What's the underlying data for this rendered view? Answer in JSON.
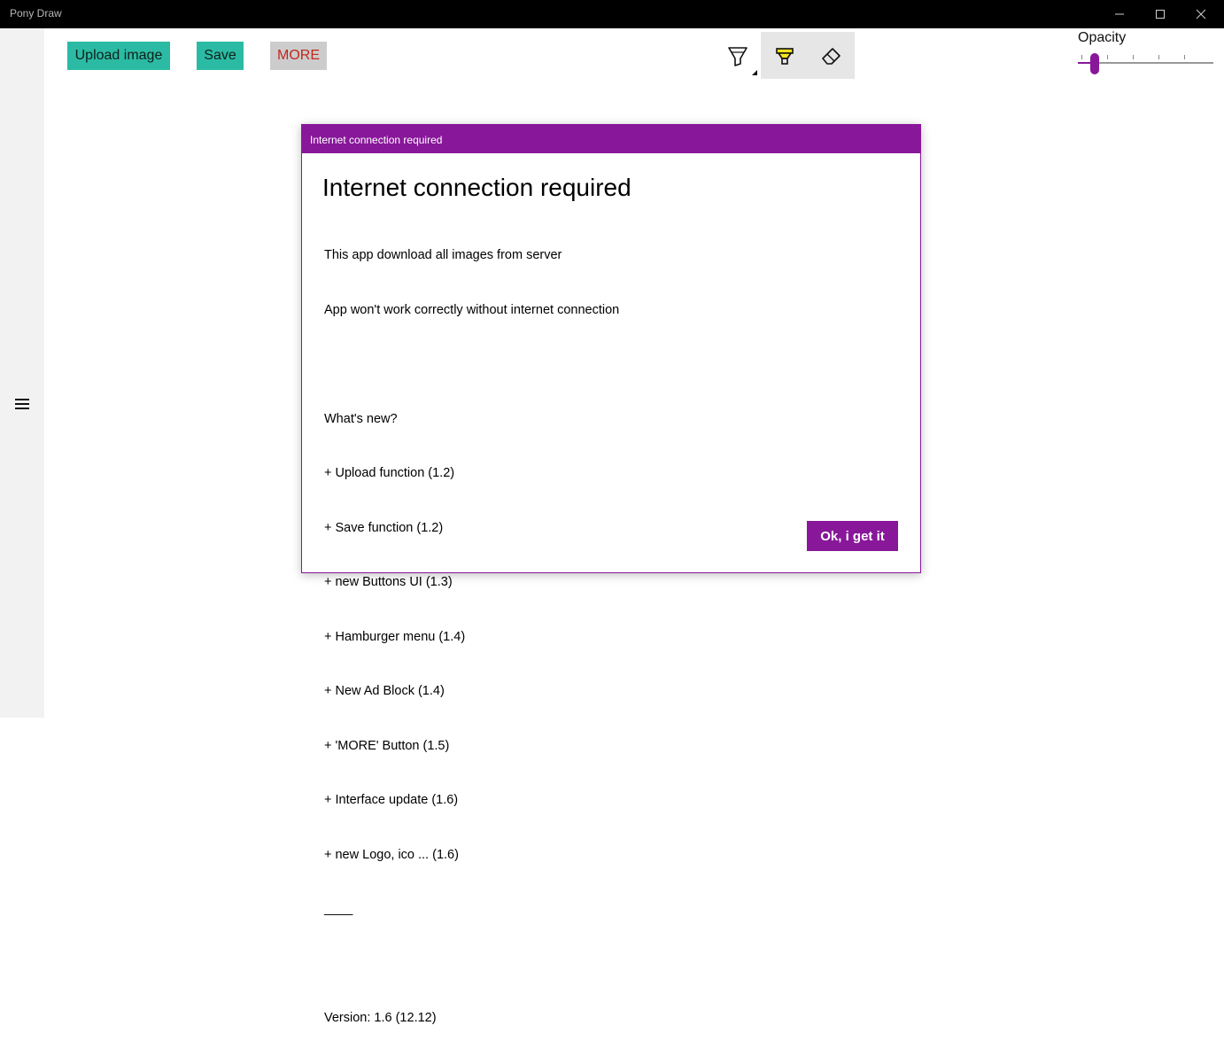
{
  "window": {
    "title": "Pony Draw"
  },
  "toolbar": {
    "upload_label": "Upload image",
    "save_label": "Save",
    "more_label": "MORE",
    "tools": [
      "pen-icon",
      "highlighter-icon",
      "eraser-icon"
    ],
    "selected_tool": "highlighter",
    "opacity_label": "Opacity",
    "opacity_value": 0.1
  },
  "dialog": {
    "header": "Internet connection required",
    "title": "Internet connection required",
    "lines": [
      "This app download all images from server",
      "App won't work correctly without internet connection",
      "",
      "What's new?",
      "+ Upload function (1.2)",
      "+ Save function (1.2)",
      "+ new Buttons UI (1.3)",
      "+ Hamburger menu (1.4)",
      "+ New Ad Block (1.4)",
      "+ 'MORE' Button (1.5)",
      "+ Interface update (1.6)",
      "+ new Logo, ico ... (1.6)",
      "____",
      "",
      "Version: 1.6 (12.12)"
    ],
    "ok_label": "Ok, i get it"
  },
  "colors": {
    "accent": "#88179a",
    "teal": "#2bbba4",
    "more_text": "#c0281e",
    "titlebar": "#000000"
  }
}
